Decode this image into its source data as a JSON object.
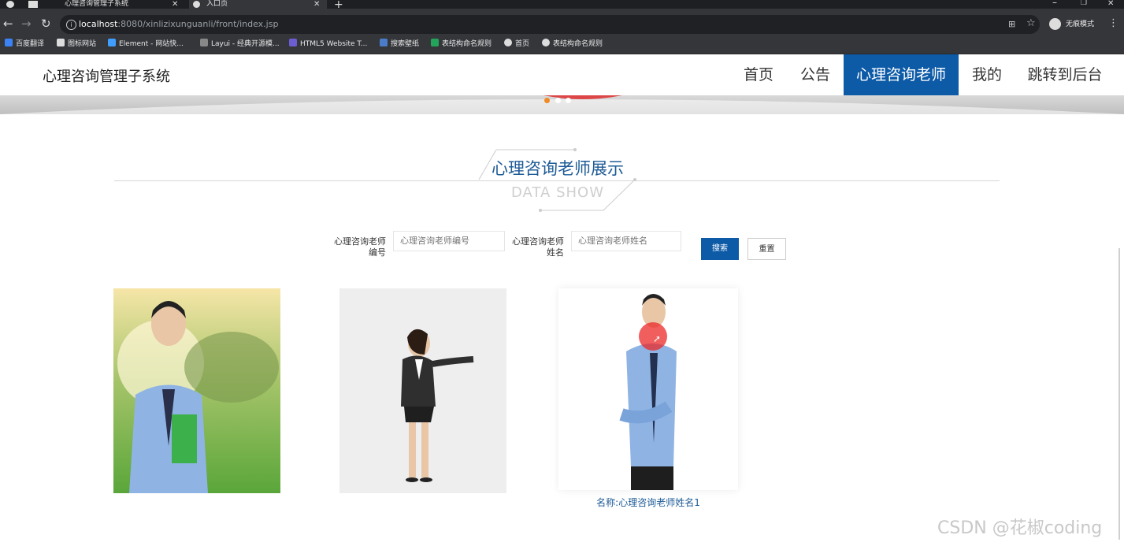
{
  "browser": {
    "tabs": [
      {
        "title": "心理咨询管理子系统",
        "active": false
      },
      {
        "title": "入口页",
        "active": true
      }
    ],
    "url_host": "localhost",
    "url_rest": ":8080/xinlizixunguanli/front/index.jsp",
    "profile_label": "无痕模式",
    "bookmarks": [
      "百度翻译",
      "图标网站",
      "Element - 网站快...",
      "Layui - 经典开源模...",
      "HTML5 Website T...",
      "搜索壁纸",
      "表结构命名规则",
      "首页",
      "表结构命名规则"
    ]
  },
  "site": {
    "brand": "心理咨询管理子系统",
    "nav": [
      "首页",
      "公告",
      "心理咨询老师",
      "我的",
      "跳转到后台"
    ],
    "active_nav_index": 2,
    "accent_color": "#0d5aa7"
  },
  "section": {
    "title": "心理咨询老师展示",
    "subtitle": "DATA SHOW"
  },
  "search": {
    "id_label": "心理咨询老师编号",
    "id_placeholder": "心理咨询老师编号",
    "name_label": "心理咨询老师姓名",
    "name_placeholder": "心理咨询老师姓名",
    "search_button": "搜索",
    "reset_button": "重置"
  },
  "teachers": [
    {
      "photo": "man-with-book-outdoors"
    },
    {
      "photo": "woman-in-suit-presenting"
    },
    {
      "photo": "man-in-blue-shirt-thinking",
      "caption": "名称:心理咨询老师姓名1"
    }
  ],
  "watermark": "CSDN @花椒coding"
}
